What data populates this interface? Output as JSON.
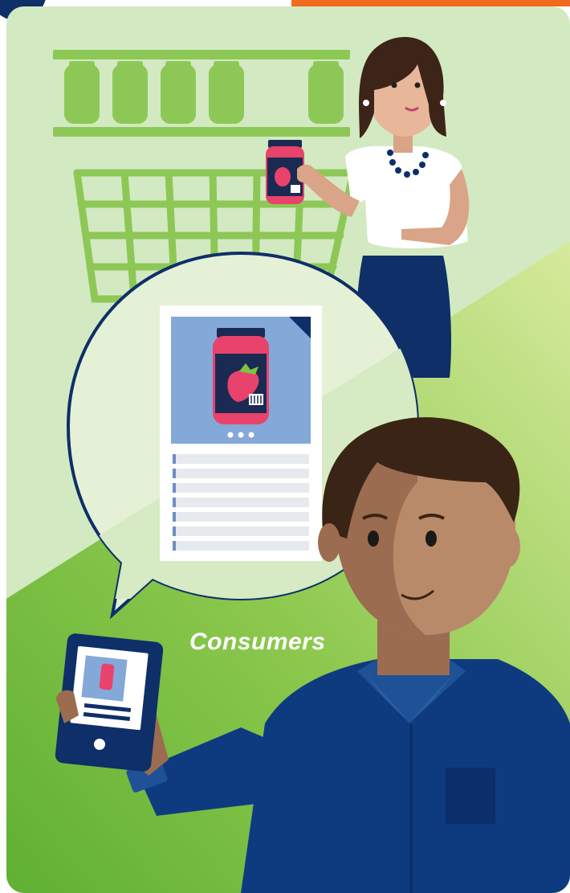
{
  "caption": {
    "label": "Consumers"
  },
  "colors": {
    "background_light_green": "#d3e9c2",
    "background_mid_green": "#7cc244",
    "background_pale_green": "#cde6a6",
    "navy": "#0e2f68",
    "shirt_blue": "#0e3b80",
    "accent_orange": "#f26b1d",
    "jar_pink": "#e9436b",
    "jar_lid_dark": "#1b2a52",
    "card_image_blue": "#84a9d8",
    "skin_tan": "#b98a6a",
    "skin_dark": "#9b6c4f",
    "hair_dark": "#3a2415"
  },
  "icons": {
    "product_jar": "strawberry-jar-icon",
    "phone": "smartphone-icon",
    "card_menu": "more-dots-icon"
  }
}
